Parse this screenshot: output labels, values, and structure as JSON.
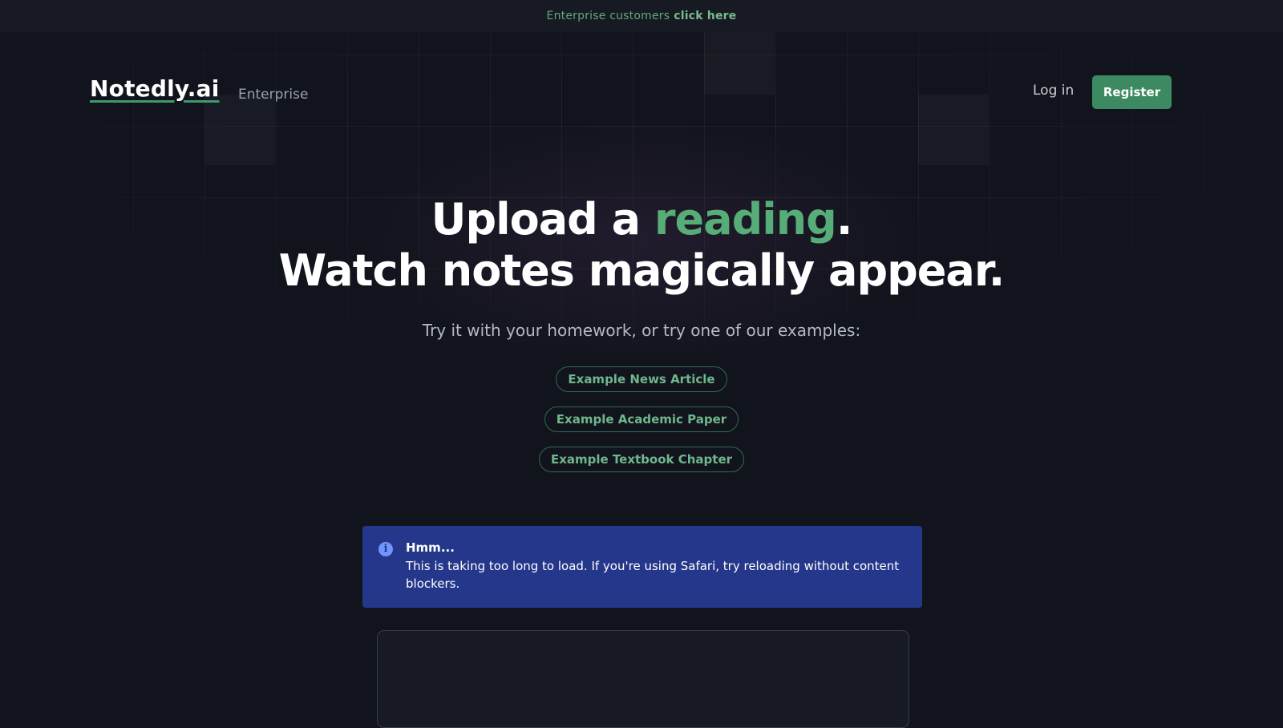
{
  "announcement": {
    "lead": "Enterprise customers",
    "link": "click here"
  },
  "header": {
    "logo": "Notedly.ai",
    "nav_enterprise": "Enterprise",
    "login": "Log in",
    "register": "Register"
  },
  "hero": {
    "line1_before": "Upload a ",
    "line1_accent": "reading",
    "line1_after": ".",
    "line2": "Watch notes magically appear."
  },
  "subtitle": "Try it with your homework, or try one of our examples:",
  "examples": [
    "Example News Article",
    "Example Academic Paper",
    "Example Textbook Chapter"
  ],
  "alert": {
    "icon": "info-icon",
    "title": "Hmm...",
    "body": "This is taking too long to load. If you're using Safari, try reloading without content blockers."
  },
  "colors": {
    "background": "#12141d",
    "accent_green": "#57ad78",
    "register_bg": "#3c8a62",
    "alert_bg": "#24378a"
  }
}
